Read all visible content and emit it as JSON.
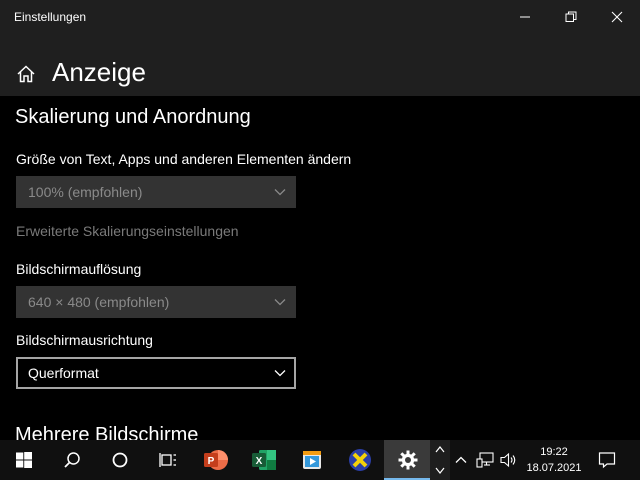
{
  "window": {
    "title": "Einstellungen",
    "controls": [
      "minimize-icon",
      "restore-icon",
      "close-icon"
    ]
  },
  "header": {
    "home_icon": "home-icon",
    "title": "Anzeige"
  },
  "content": {
    "section_title": "Skalierung und Anordnung",
    "scale": {
      "label": "Größe von Text, Apps und anderen Elementen ändern",
      "value": "100% (empfohlen)"
    },
    "advanced_link": "Erweiterte Skalierungseinstellungen",
    "resolution": {
      "label": "Bildschirmauflösung",
      "value": "640 × 480 (empfohlen)"
    },
    "orientation": {
      "label": "Bildschirmausrichtung",
      "value": "Querformat"
    },
    "next_section_title": "Mehrere Bildschirme"
  },
  "taskbar": {
    "items": [
      "windows-start-icon",
      "search-icon",
      "cortana-icon",
      "task-view-icon",
      "powerpoint-icon",
      "excel-icon",
      "media-player-icon",
      "xming-icon",
      "settings-icon"
    ],
    "active_item": "settings-icon",
    "tray_icons": [
      "show-hidden-icons-chevron",
      "network-icon",
      "volume-icon",
      "notification-icon"
    ],
    "clock": {
      "time": "19:22",
      "date": "18.07.2021"
    }
  },
  "colors": {
    "background": "#000000",
    "titlebar": "#1f1f1f",
    "dropdown_disabled": "#333333",
    "accent_underline": "#76b9ed"
  }
}
